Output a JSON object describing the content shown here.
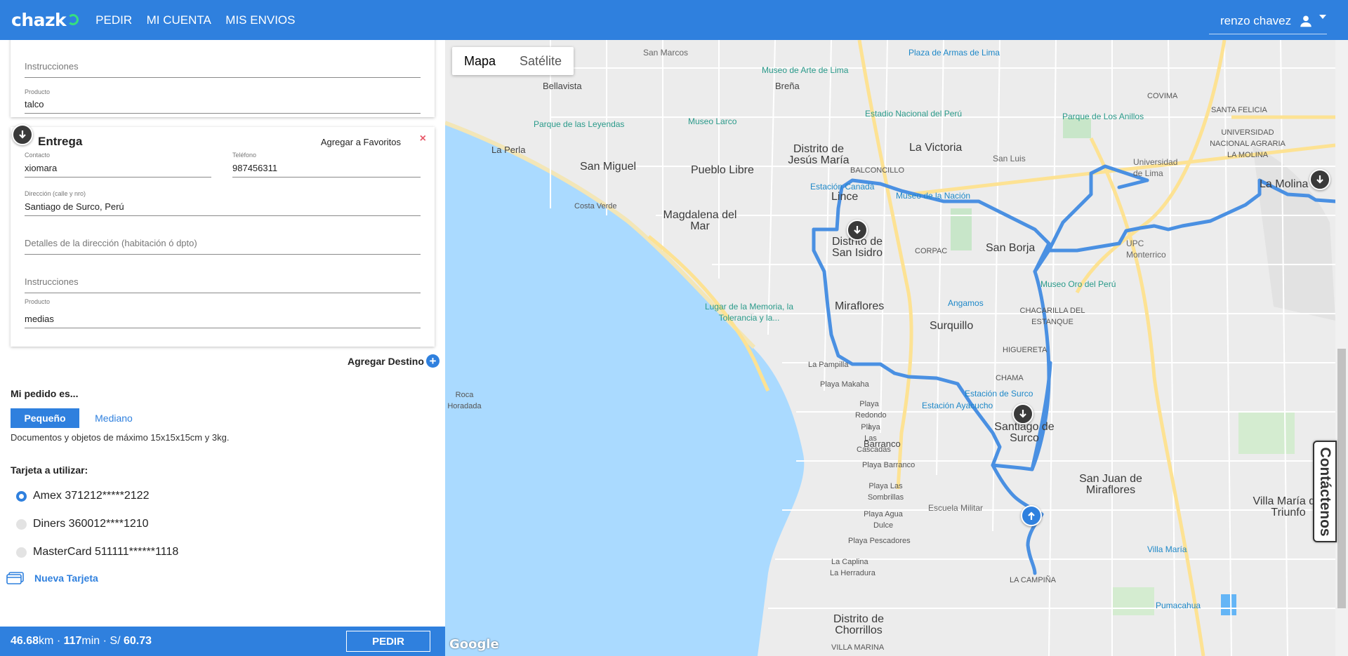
{
  "header": {
    "logo": "chazk",
    "nav": [
      "PEDIR",
      "MI CUENTA",
      "MIS ENVIOS"
    ],
    "user": "renzo chavez"
  },
  "prev_stop": {
    "instrucciones_placeholder": "Instrucciones",
    "producto_label": "Producto",
    "producto_value": "talco"
  },
  "entrega": {
    "title": "Entrega",
    "favorites": "Agregar a Favoritos",
    "close": "×",
    "contacto_label": "Contacto",
    "contacto_value": "xiomara",
    "telefono_label": "Teléfono",
    "telefono_value": "987456311",
    "direccion_label": "Dirección (calle y nro)",
    "direccion_value": "Santiago de Surco, Perú",
    "detalles_placeholder": "Detalles de la dirección (habitación ó dpto)",
    "instrucciones_placeholder": "Instrucciones",
    "producto_label": "Producto",
    "producto_value": "medias"
  },
  "add_destination": "Agregar Destino",
  "order": {
    "label": "Mi pedido es...",
    "sizes": [
      "Pequeño",
      "Mediano"
    ],
    "selected_size": "Pequeño",
    "description": "Documentos y objetos de máximo 15x15x15cm y 3kg."
  },
  "payment": {
    "label": "Tarjeta a utilizar:",
    "cards": [
      "Amex 371212*****2122",
      "Diners 360012****1210",
      "MasterCard 511111******1118"
    ],
    "selected_index": 0,
    "new_card": "Nueva Tarjeta"
  },
  "summary": {
    "km": "46.68",
    "km_unit": "km",
    "sep1": " · ",
    "min": "117",
    "min_unit": "min",
    "sep2": " · S/ ",
    "price": "60.73",
    "button": "PEDIR"
  },
  "map": {
    "types": [
      "Mapa",
      "Satélite"
    ],
    "selected_type": "Mapa",
    "attribution": "Google",
    "districts": [
      "San Miguel",
      "Pueblo Libre",
      "Distrito de Jesús María",
      "La Victoria",
      "Magdalena del Mar",
      "Lince",
      "Distrito de San Isidro",
      "San Borja",
      "Miraflores",
      "Surquillo",
      "Santiago de Surco",
      "San Juan de Miraflores",
      "Distrito de Chorrillos",
      "La Molina",
      "Villa María del Triunfo",
      "Barranco",
      "Bellavista",
      "La Perla",
      "Breña",
      "COVIMA",
      "SANTA FELICIA",
      "BALCONCILLO",
      "CORPAC",
      "CHACARILLA DEL ESTANQUE",
      "HIGUERETA",
      "CHAMA",
      "LA CAMPIÑA",
      "VILLA MARINA",
      "UPC Monterrico",
      "Universidad de Lima",
      "San Luis",
      "Costa Verde",
      "La Pampilla",
      "Playa Makaha",
      "Playa Redondo I",
      "Playa Las Cascadas",
      "Playa Barranco",
      "Playa Las Sombrillas",
      "Playa Agua Dulce",
      "Playa Pescadores",
      "La Caplina",
      "La Herradura",
      "Roca Horadada"
    ],
    "pois": [
      "Museo de Arte de Lima",
      "Estadio Nacional del Perú",
      "Museo Larco",
      "Parque de las Leyendas",
      "Estación Canadá",
      "Museo de la Nación",
      "Parque de Los Anillos",
      "Museo Oro del Perú",
      "Angamos",
      "Estación de Surco",
      "Estación Ayacucho",
      "Lugar de la Memoria, la Tolerancia y la...",
      "Escuela Militar",
      "Villa María",
      "Pumacahua",
      "Plaza de Armas de Lima",
      "San Marcos",
      "UNIVERSIDAD NACIONAL AGRARIA LA MOLINA"
    ]
  },
  "contact": "Contáctenos"
}
